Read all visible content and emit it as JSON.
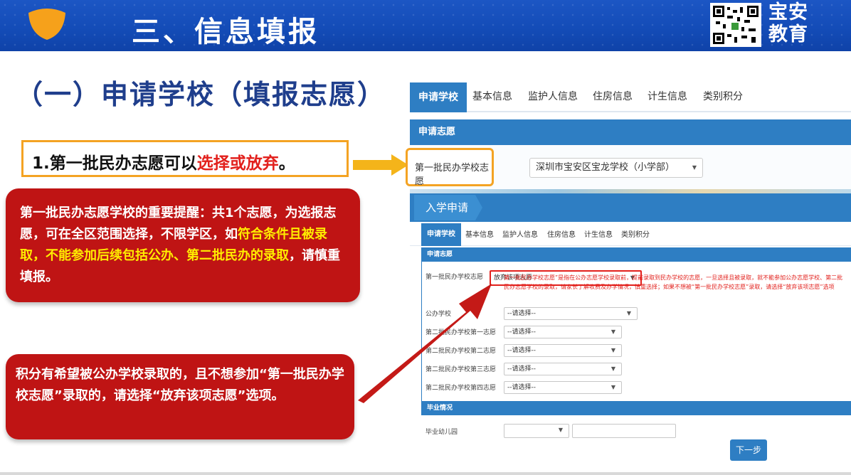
{
  "banner": {
    "title": "三、信息填报",
    "brand_line1": "宝安",
    "brand_line2": "教育"
  },
  "section_title": "（一）申请学校（填报志愿）",
  "note": {
    "prefix": "1.第一批民办志愿可以",
    "highlight": "选择或放弃",
    "suffix": "。"
  },
  "panel1": {
    "part1": "第一批民办志愿学校的重要提醒：共1个志愿，为选报志愿，可在全区范围选择，不限学区，如",
    "part2": "符合条件且被录取，不能参加后续包括公办、第二批民办的录取",
    "part3": "，请慎重填报。"
  },
  "panel2": {
    "text": "积分有希望被公办学校录取的，且不想参加“第一批民办学校志愿”录取的，请选择“放弃该项志愿”选项。"
  },
  "form": {
    "tabs": [
      "申请学校",
      "基本信息",
      "监护人信息",
      "住房信息",
      "计生信息",
      "类别积分"
    ],
    "section1": "申请志愿",
    "field1_label": "第一批民办学校志愿",
    "field1_value": "深圳市宝安区宝龙学校（小学部）",
    "entry_title": "入学申请",
    "tabs_small": [
      "申请学校",
      "基本信息",
      "监护人信息",
      "住房信息",
      "计生信息",
      "类别积分"
    ],
    "section2": "申请志愿",
    "rows": [
      {
        "label": "第一批民办学校志愿",
        "value": "放弃该项志愿"
      },
      {
        "label": "公办学校",
        "value": "--请选择--"
      },
      {
        "label": "第二批民办学校第一志愿",
        "value": "--请选择--"
      },
      {
        "label": "第二批民办学校第二志愿",
        "value": "--请选择--"
      },
      {
        "label": "第二批民办学校第三志愿",
        "value": "--请选择--"
      },
      {
        "label": "第二批民办学校第四志愿",
        "value": "--请选择--"
      }
    ],
    "help_text": "第一批民办学校志愿”是指在公办志愿学校录取前，提前录取到民办学校的志愿，一旦选择且被录取，就不能参加公办志愿学校、第二批民办志愿学校的录取，请家长了解收费及办学情况，慎重选择；如果不想被“第一批民办学校志愿”录取，请选择“放弃该项志愿”选项",
    "section3": "毕业情况",
    "kindergarten_label": "毕业幼儿园",
    "next_button": "下一步"
  },
  "colors": {
    "banner_blue": "#134bb6",
    "accent_red": "#bf1414",
    "highlight_yellow": "#ffec00",
    "form_blue": "#2e7ec3",
    "orange_border": "#f4a323"
  }
}
